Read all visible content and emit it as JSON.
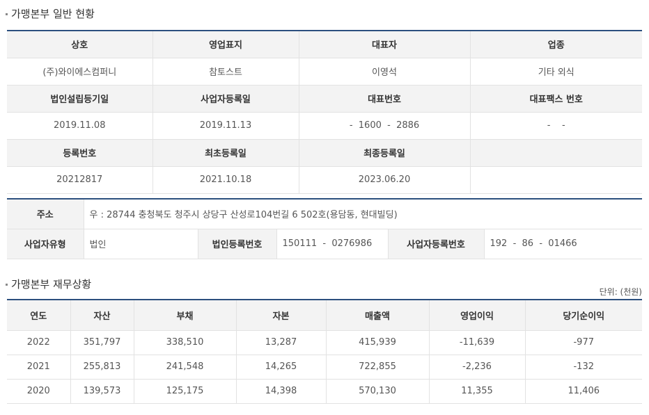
{
  "section1": {
    "title": "가맹본부 일반 현황",
    "headers_row1": [
      "상호",
      "영업표지",
      "대표자",
      "업종"
    ],
    "values_row1": [
      "(주)와이에스컴퍼니",
      "참토스트",
      "이영석",
      "기타 외식"
    ],
    "headers_row2": [
      "법인설립등기일",
      "사업자등록일",
      "대표번호",
      "대표팩스 번호"
    ],
    "values_row2": [
      "2019.11.08",
      "2019.11.13",
      "-  1600  -  2886",
      "-    -"
    ],
    "headers_row3": [
      "등록번호",
      "최초등록일",
      "최종등록일",
      ""
    ],
    "values_row3": [
      "20212817",
      "2021.10.18",
      "2023.06.20",
      ""
    ]
  },
  "address": {
    "label": "주소",
    "value": "우 : 28744 충청북도 청주시 상당구 산성로104번길 6 502호(용담동, 현대빌딩)",
    "biz_type_label": "사업자유형",
    "biz_type_value": "법인",
    "corp_reg_label": "법인등록번호",
    "corp_reg_value": "150111  -  0276986",
    "biz_reg_label": "사업자등록번호",
    "biz_reg_value": "192  -  86  -  01466"
  },
  "section2": {
    "title": "가맹본부 재무상황",
    "unit": "단위: (천원)",
    "headers": [
      "연도",
      "자산",
      "부채",
      "자본",
      "매출액",
      "영업이익",
      "당기순이익"
    ],
    "rows": [
      [
        "2022",
        "351,797",
        "338,510",
        "13,287",
        "415,939",
        "-11,639",
        "-977"
      ],
      [
        "2021",
        "255,813",
        "241,548",
        "14,265",
        "722,855",
        "-2,236",
        "-132"
      ],
      [
        "2020",
        "139,573",
        "125,175",
        "14,398",
        "570,130",
        "11,355",
        "11,406"
      ]
    ]
  }
}
